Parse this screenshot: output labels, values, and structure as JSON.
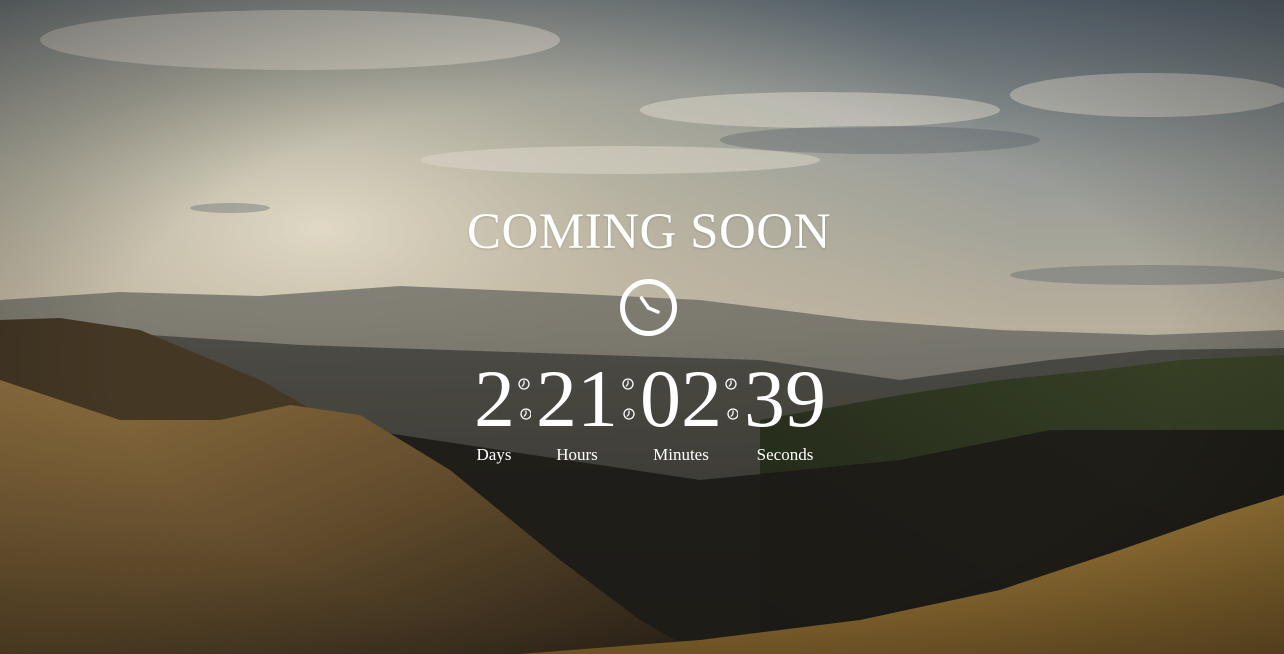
{
  "page": {
    "title": "COMING SOON"
  },
  "icons": {
    "header_icon": "clock-icon",
    "separator_icon": "small-clock-icon"
  },
  "countdown": {
    "days": {
      "value": "2",
      "label": "Days"
    },
    "hours": {
      "value": "21",
      "label": "Hours"
    },
    "minutes": {
      "value": "02",
      "label": "Minutes"
    },
    "seconds": {
      "value": "39",
      "label": "Seconds"
    }
  },
  "colors": {
    "text": "#ffffff",
    "sky_top": "#6f7f8c",
    "sky_glow": "#efe5cf",
    "hills_dark": "#26221b",
    "grass": "#b8892f"
  }
}
